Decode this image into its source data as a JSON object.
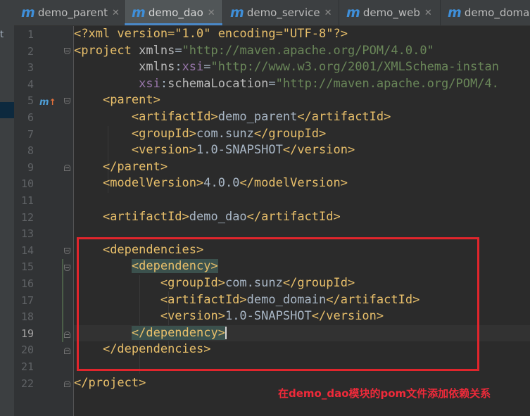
{
  "left_panel": {
    "fragment": "t"
  },
  "tabs": [
    {
      "label": "demo_parent",
      "active": false,
      "closable": true
    },
    {
      "label": "demo_dao",
      "active": true,
      "closable": true
    },
    {
      "label": "demo_service",
      "active": false,
      "closable": true
    },
    {
      "label": "demo_web",
      "active": false,
      "closable": true
    },
    {
      "label": "demo_doma",
      "active": false,
      "closable": false
    }
  ],
  "tab_icon": "m",
  "close_glyph": "✕",
  "current_line": 19,
  "line_numbers": [
    "1",
    "2",
    "3",
    "4",
    "5",
    "6",
    "7",
    "8",
    "9",
    "10",
    "11",
    "12",
    "13",
    "14",
    "15",
    "16",
    "17",
    "18",
    "19",
    "20",
    "21",
    "22"
  ],
  "code": {
    "l1_decl": "<?xml version=\"1.0\" encoding=\"UTF-8\"?>",
    "l2_open": "<project ",
    "l2_attr": "xmlns",
    "l2_val": "\"http://maven.apache.org/POM/4.0.0\"",
    "l3_ns": "xmlns",
    "l3_prefix": "xsi",
    "l3_val": "\"http://www.w3.org/2001/XMLSchema-instan",
    "l4_ns": "xsi",
    "l4_attr": "schemaLocation",
    "l4_val": "\"http://maven.apache.org/POM/4.",
    "parent_open": "<parent>",
    "artifact_open": "<artifactId>",
    "artifact_close": "</artifactId>",
    "group_open": "<groupId>",
    "group_close": "</groupId>",
    "version_open": "<version>",
    "version_close": "</version>",
    "parent_close": "</parent>",
    "model_open": "<modelVersion>",
    "model_close": "</modelVersion>",
    "model_value": "4.0.0",
    "parent_artifact": "demo_parent",
    "parent_group": "com.sunz",
    "parent_version": "1.0-SNAPSHOT",
    "own_artifact": "demo_dao",
    "deps_open": "<dependencies>",
    "dep_open": "<dependency>",
    "dep_group": "com.sunz",
    "dep_artifact": "demo_domain",
    "dep_version": "1.0-SNAPSHOT",
    "dep_close": "</dependency>",
    "deps_close": "</dependencies>",
    "project_close": "</project>"
  },
  "annotation": {
    "text": "在demo_dao模块的pom文件添加依赖关系",
    "color": "#f02a3a"
  },
  "icons": {
    "gutter_maven": "maven-override-icon",
    "gutter_hint": "lightbulb-icon",
    "fold": "fold-marker-icon"
  }
}
